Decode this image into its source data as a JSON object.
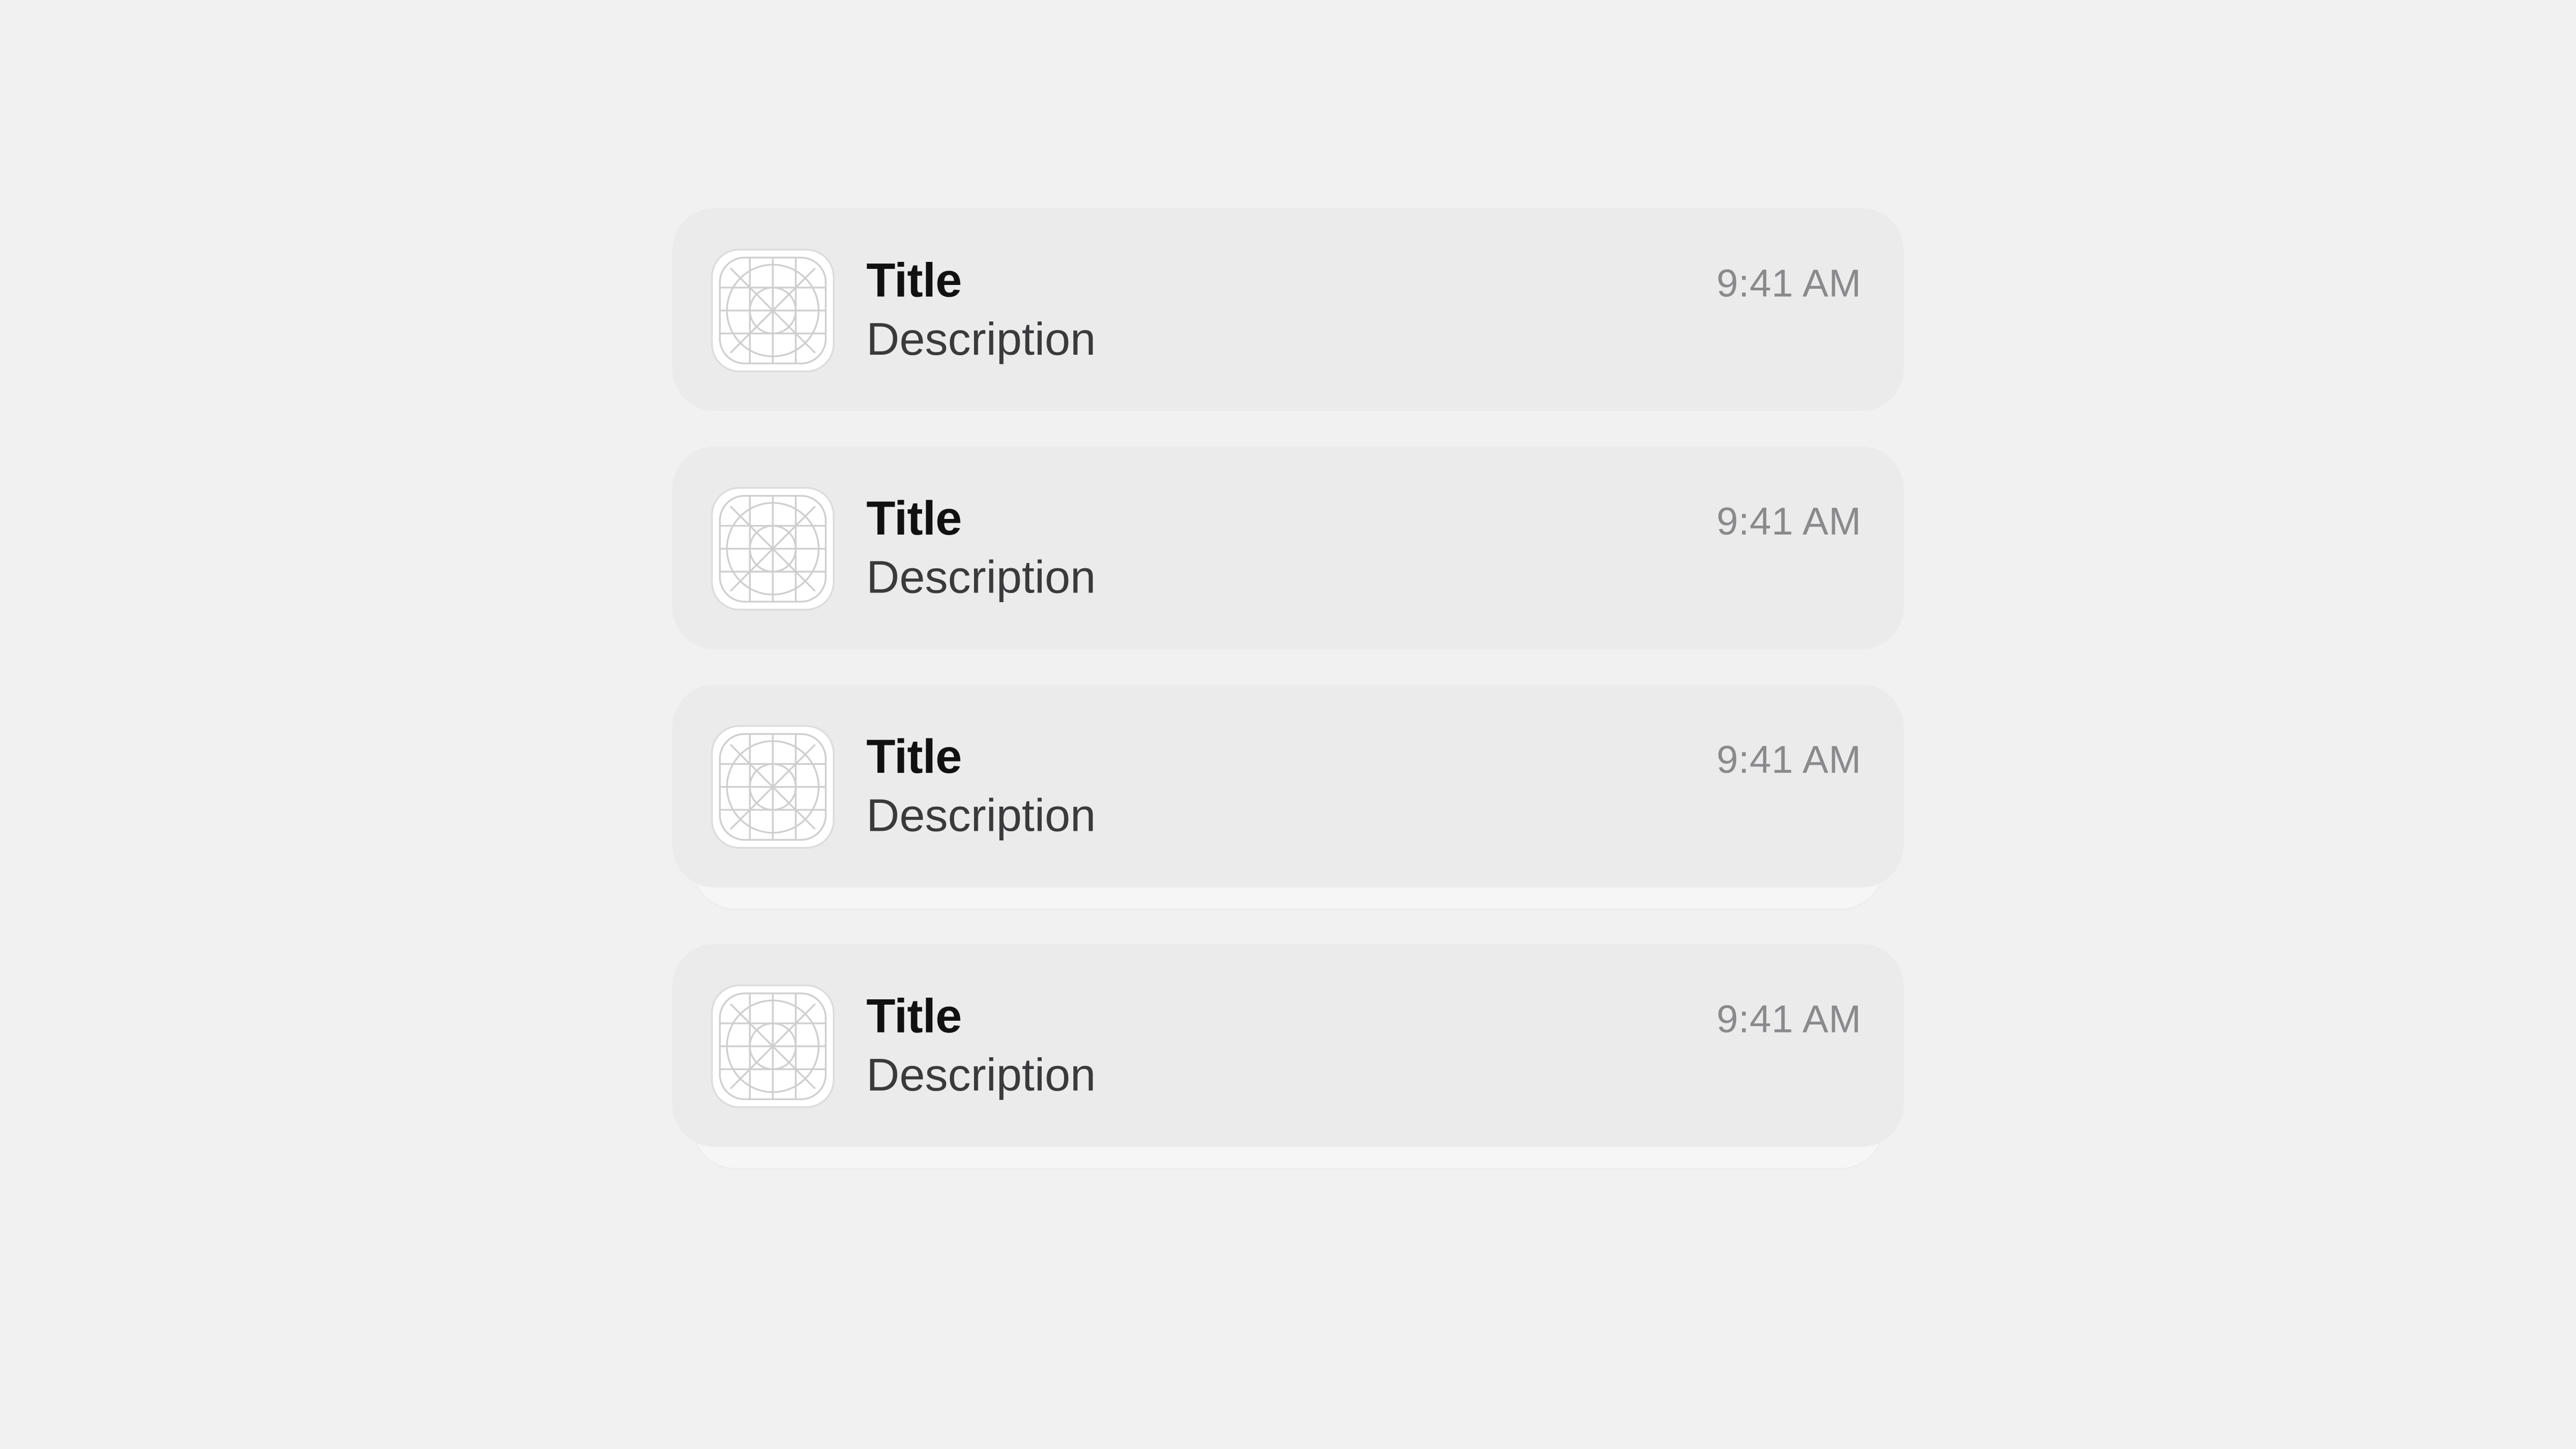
{
  "notifications": [
    {
      "title": "Title",
      "description": "Description",
      "time": "9:41 AM",
      "stacked": false
    },
    {
      "title": "Title",
      "description": "Description",
      "time": "9:41 AM",
      "stacked": false
    },
    {
      "title": "Title",
      "description": "Description",
      "time": "9:41 AM",
      "stacked": true
    },
    {
      "title": "Title",
      "description": "Description",
      "time": "9:41 AM",
      "stacked": true
    }
  ]
}
